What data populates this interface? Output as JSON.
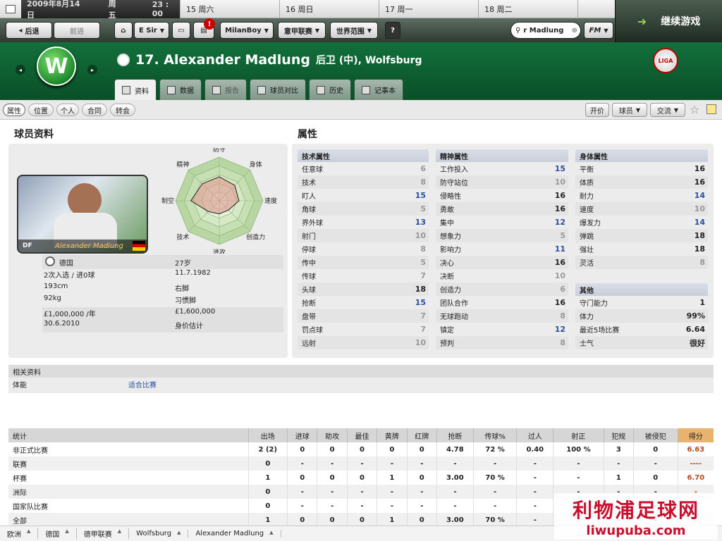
{
  "datebar": {
    "current": {
      "date": "2009年8月14日",
      "weekday": "周五",
      "time": "23 : 00"
    },
    "days": [
      "15 周六",
      "16 周日",
      "17 周一",
      "18 周二"
    ],
    "nav": [
      "◂",
      "●",
      "▸"
    ]
  },
  "continue_label": "继续游戏",
  "toolbar": {
    "back": "后退",
    "forward": "前进",
    "manager": "E Sir",
    "alert_count": "!",
    "user": "MilanBoy",
    "league": "意甲联赛",
    "world": "世界范围",
    "help": "?",
    "search_value": "r Madlung",
    "fm_label": "FM"
  },
  "header": {
    "club_initial": "W",
    "player_title": "17. Alexander Madlung",
    "position_club": "后卫 (中), Wolfsburg",
    "league_badge": "LIGA",
    "tabs": [
      "资料",
      "数据",
      "报告",
      "球员对比",
      "历史",
      "记事本"
    ]
  },
  "subbar": {
    "tabs": [
      "属性",
      "位置",
      "个人",
      "合同",
      "转会"
    ],
    "actions": {
      "offer": "开价",
      "player": "球员",
      "interact": "交流"
    }
  },
  "profile": {
    "title": "球员资料",
    "card_name": "Alexander Madlung",
    "card_pos": "DF",
    "radar_labels": [
      "防守",
      "身体",
      "速度",
      "创造力",
      "进攻",
      "技术",
      "制空",
      "精神"
    ],
    "radar_values": [
      0.55,
      0.5,
      0.45,
      0.3,
      0.3,
      0.35,
      0.65,
      0.55
    ],
    "nation": "德国",
    "caps": "2次入选 / 进0球",
    "age": "27岁",
    "dob": "11.7.1982",
    "height": "193cm",
    "weight": "92kg",
    "foot": "右脚",
    "foot_label": "习惯脚",
    "wage": "£1,000,000 /年",
    "contract": "30.6.2010",
    "value": "£1,600,000",
    "value_label": "身价估计"
  },
  "attributes": {
    "title": "属性",
    "technical": {
      "title": "技术属性",
      "rows": [
        {
          "name": "任意球",
          "value": "6",
          "tone": "g"
        },
        {
          "name": "技术",
          "value": "8",
          "tone": "g"
        },
        {
          "name": "盯人",
          "value": "15",
          "tone": "b"
        },
        {
          "name": "角球",
          "value": "5",
          "tone": "g"
        },
        {
          "name": "界外球",
          "value": "13",
          "tone": "b"
        },
        {
          "name": "射门",
          "value": "10",
          "tone": "g"
        },
        {
          "name": "停球",
          "value": "8",
          "tone": "g"
        },
        {
          "name": "传中",
          "value": "5",
          "tone": "g"
        },
        {
          "name": "传球",
          "value": "7",
          "tone": "g"
        },
        {
          "name": "头球",
          "value": "18",
          "tone": "k"
        },
        {
          "name": "抢断",
          "value": "15",
          "tone": "b"
        },
        {
          "name": "盘带",
          "value": "7",
          "tone": "g"
        },
        {
          "name": "罚点球",
          "value": "7",
          "tone": "g"
        },
        {
          "name": "远射",
          "value": "10",
          "tone": "g"
        }
      ]
    },
    "mental": {
      "title": "精神属性",
      "rows": [
        {
          "name": "工作投入",
          "value": "15",
          "tone": "b"
        },
        {
          "name": "防守站位",
          "value": "10",
          "tone": "g"
        },
        {
          "name": "侵略性",
          "value": "16",
          "tone": "k"
        },
        {
          "name": "勇敢",
          "value": "16",
          "tone": "k"
        },
        {
          "name": "集中",
          "value": "12",
          "tone": "b"
        },
        {
          "name": "想象力",
          "value": "5",
          "tone": "g"
        },
        {
          "name": "影响力",
          "value": "11",
          "tone": "b"
        },
        {
          "name": "决心",
          "value": "16",
          "tone": "k"
        },
        {
          "name": "决断",
          "value": "10",
          "tone": "g"
        },
        {
          "name": "创造力",
          "value": "6",
          "tone": "g"
        },
        {
          "name": "团队合作",
          "value": "16",
          "tone": "k"
        },
        {
          "name": "无球跑动",
          "value": "8",
          "tone": "g"
        },
        {
          "name": "镇定",
          "value": "12",
          "tone": "b"
        },
        {
          "name": "预判",
          "value": "8",
          "tone": "g"
        }
      ]
    },
    "physical": {
      "title": "身体属性",
      "rows": [
        {
          "name": "平衡",
          "value": "16",
          "tone": "k"
        },
        {
          "name": "体质",
          "value": "16",
          "tone": "k"
        },
        {
          "name": "耐力",
          "value": "14",
          "tone": "b"
        },
        {
          "name": "速度",
          "value": "10",
          "tone": "g"
        },
        {
          "name": "爆发力",
          "value": "14",
          "tone": "b"
        },
        {
          "name": "弹跳",
          "value": "18",
          "tone": "k"
        },
        {
          "name": "强壮",
          "value": "18",
          "tone": "k"
        },
        {
          "name": "灵活",
          "value": "8",
          "tone": "g"
        }
      ]
    },
    "other": {
      "title": "其他",
      "rows": [
        {
          "name": "守门能力",
          "value": "1",
          "tone": "k"
        },
        {
          "name": "体力",
          "value": "99%",
          "tone": "k"
        },
        {
          "name": "最近5场比赛",
          "value": "6.64",
          "tone": "k"
        },
        {
          "name": "士气",
          "value": "很好",
          "tone": "k"
        }
      ]
    }
  },
  "related": {
    "title": "相关资料",
    "label": "体能",
    "value": "适合比赛"
  },
  "stats": {
    "headers": [
      "统计",
      "出场",
      "进球",
      "助攻",
      "最佳",
      "黄牌",
      "红牌",
      "抢断",
      "传球%",
      "过人",
      "射正",
      "犯规",
      "被侵犯",
      "得分"
    ],
    "rows": [
      [
        "非正式比赛",
        "2 (2)",
        "0",
        "0",
        "0",
        "0",
        "0",
        "4.78",
        "72 %",
        "0.40",
        "100 %",
        "3",
        "0",
        "6.63"
      ],
      [
        "联赛",
        "0",
        "-",
        "-",
        "-",
        "-",
        "-",
        "-",
        "-",
        "-",
        "-",
        "-",
        "-",
        "----"
      ],
      [
        "杯赛",
        "1",
        "0",
        "0",
        "0",
        "1",
        "0",
        "3.00",
        "70 %",
        "-",
        "-",
        "1",
        "0",
        "6.70"
      ],
      [
        "洲际",
        "0",
        "-",
        "-",
        "-",
        "-",
        "-",
        "-",
        "-",
        "-",
        "-",
        "-",
        "-",
        "-"
      ],
      [
        "国家队比赛",
        "0",
        "-",
        "-",
        "-",
        "-",
        "-",
        "-",
        "-",
        "-",
        "-",
        "-",
        "-",
        "-"
      ],
      [
        "全部",
        "1",
        "0",
        "0",
        "0",
        "1",
        "0",
        "3.00",
        "70 %",
        "-",
        "-",
        "-",
        "-",
        "-"
      ]
    ]
  },
  "footer": [
    "欧洲",
    "德国",
    "德甲联赛",
    "Wolfsburg",
    "Alexander Madlung"
  ],
  "watermark": {
    "line1": "利物浦足球网",
    "line2": "liwupuba.com"
  }
}
